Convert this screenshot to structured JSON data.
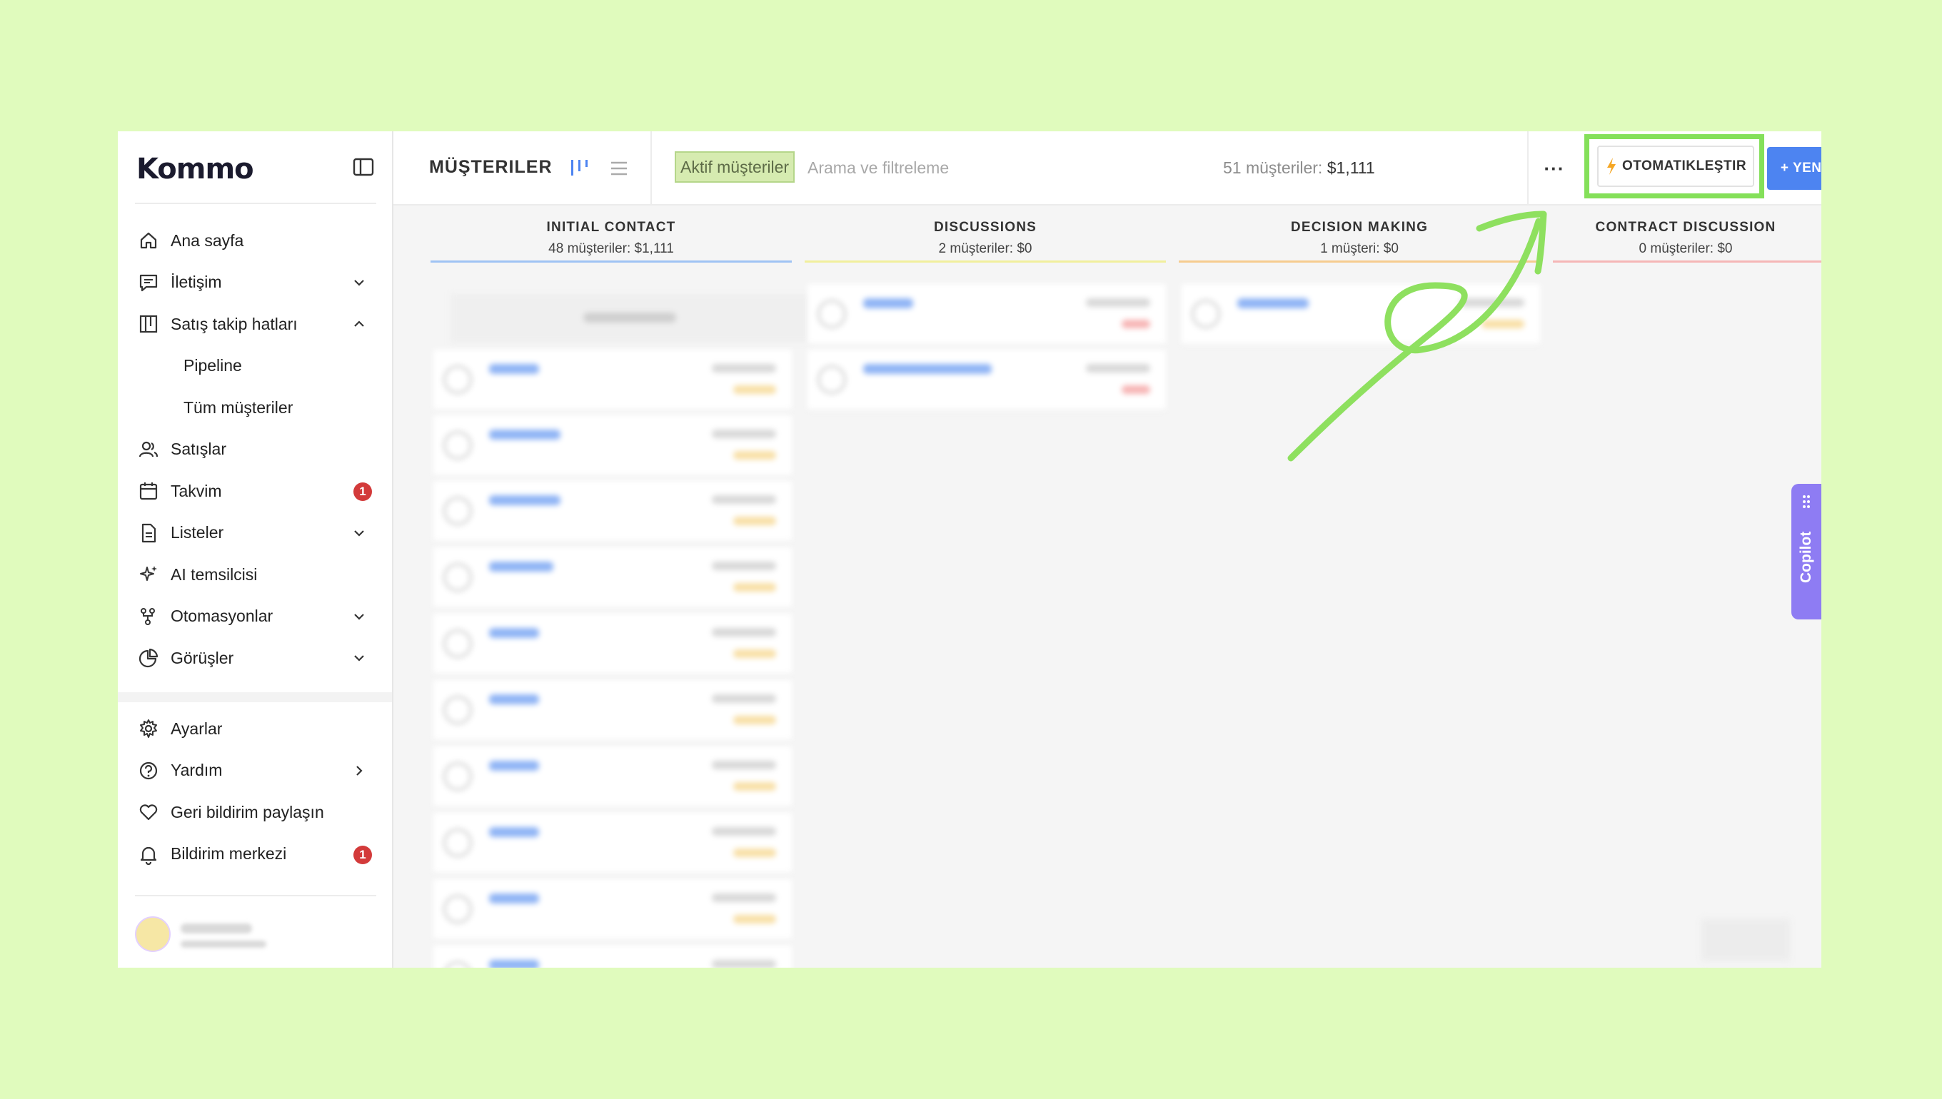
{
  "app": {
    "logo": "Kommo"
  },
  "sidebar": {
    "items": [
      {
        "label": "Ana sayfa",
        "icon": "home-icon"
      },
      {
        "label": "İletişim",
        "icon": "chat-icon",
        "chevron": "down"
      },
      {
        "label": "Satış takip hatları",
        "icon": "pipeline-icon",
        "chevron": "up"
      },
      {
        "label": "Pipeline",
        "sub": true
      },
      {
        "label": "Tüm müşteriler",
        "sub": true
      },
      {
        "label": "Satışlar",
        "icon": "users-icon"
      },
      {
        "label": "Takvim",
        "icon": "calendar-icon",
        "badge": "1"
      },
      {
        "label": "Listeler",
        "icon": "document-icon",
        "chevron": "down"
      },
      {
        "label": "AI temsilcisi",
        "icon": "sparkle-icon"
      },
      {
        "label": "Otomasyonlar",
        "icon": "flow-icon",
        "chevron": "down"
      },
      {
        "label": "Görüşler",
        "icon": "pie-chart-icon",
        "chevron": "down"
      }
    ],
    "bottom_items": [
      {
        "label": "Ayarlar",
        "icon": "gear-icon"
      },
      {
        "label": "Yardım",
        "icon": "help-icon",
        "chevron": "right"
      },
      {
        "label": "Geri bildirim paylaşın",
        "icon": "heart-icon"
      },
      {
        "label": "Bildirim merkezi",
        "icon": "bell-icon",
        "badge": "1"
      }
    ]
  },
  "header": {
    "title": "MÜŞTERILER",
    "filter_chip": "Aktif müşteriler",
    "search_placeholder": "Arama ve filtreleme",
    "summary_count": "51 müşteriler:",
    "summary_amount": "$1,111",
    "more_label": "···",
    "automate_label": "OTOMATIKLEŞTIR",
    "new_label": "+ YENI MÜŞTERI"
  },
  "columns": [
    {
      "name": "INITIAL CONTACT",
      "meta": "48 müşteriler: $1,111",
      "color": "#9fc3f4"
    },
    {
      "name": "DISCUSSIONS",
      "meta": "2 müşteriler: $0",
      "color": "#f1ef9d"
    },
    {
      "name": "DECISION MAKING",
      "meta": "1 müşteri: $0",
      "color": "#f6cc8f"
    },
    {
      "name": "CONTRACT DISCUSSION",
      "meta": "0 müşteriler: $0",
      "color": "#f5b6b6"
    }
  ],
  "copilot": {
    "label": "Copilot"
  },
  "colors": {
    "highlight": "#84e059",
    "primary": "#4d84f1",
    "background": "#e0fbbd"
  }
}
